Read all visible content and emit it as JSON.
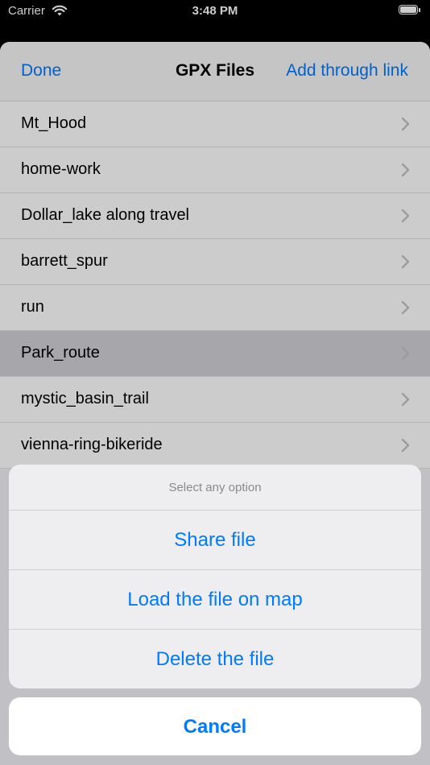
{
  "status_bar": {
    "carrier": "Carrier",
    "time": "3:48 PM",
    "wifi_icon": "wifi-icon",
    "battery_icon": "battery-icon"
  },
  "nav": {
    "left_button": "Done",
    "title": "GPX Files",
    "right_button": "Add through link"
  },
  "files": [
    {
      "name": "Mt_Hood"
    },
    {
      "name": "home-work"
    },
    {
      "name": "Dollar_lake along travel"
    },
    {
      "name": "barrett_spur"
    },
    {
      "name": "run"
    },
    {
      "name": "Park_route",
      "selected": true
    },
    {
      "name": "mystic_basin_trail"
    },
    {
      "name": "vienna-ring-bikeride"
    }
  ],
  "action_sheet": {
    "title": "Select any option",
    "actions": [
      "Share file",
      "Load the file on map",
      "Delete the file"
    ],
    "cancel": "Cancel"
  },
  "colors": {
    "accent": "#007aff",
    "selected_row": "#d1d1d6"
  }
}
